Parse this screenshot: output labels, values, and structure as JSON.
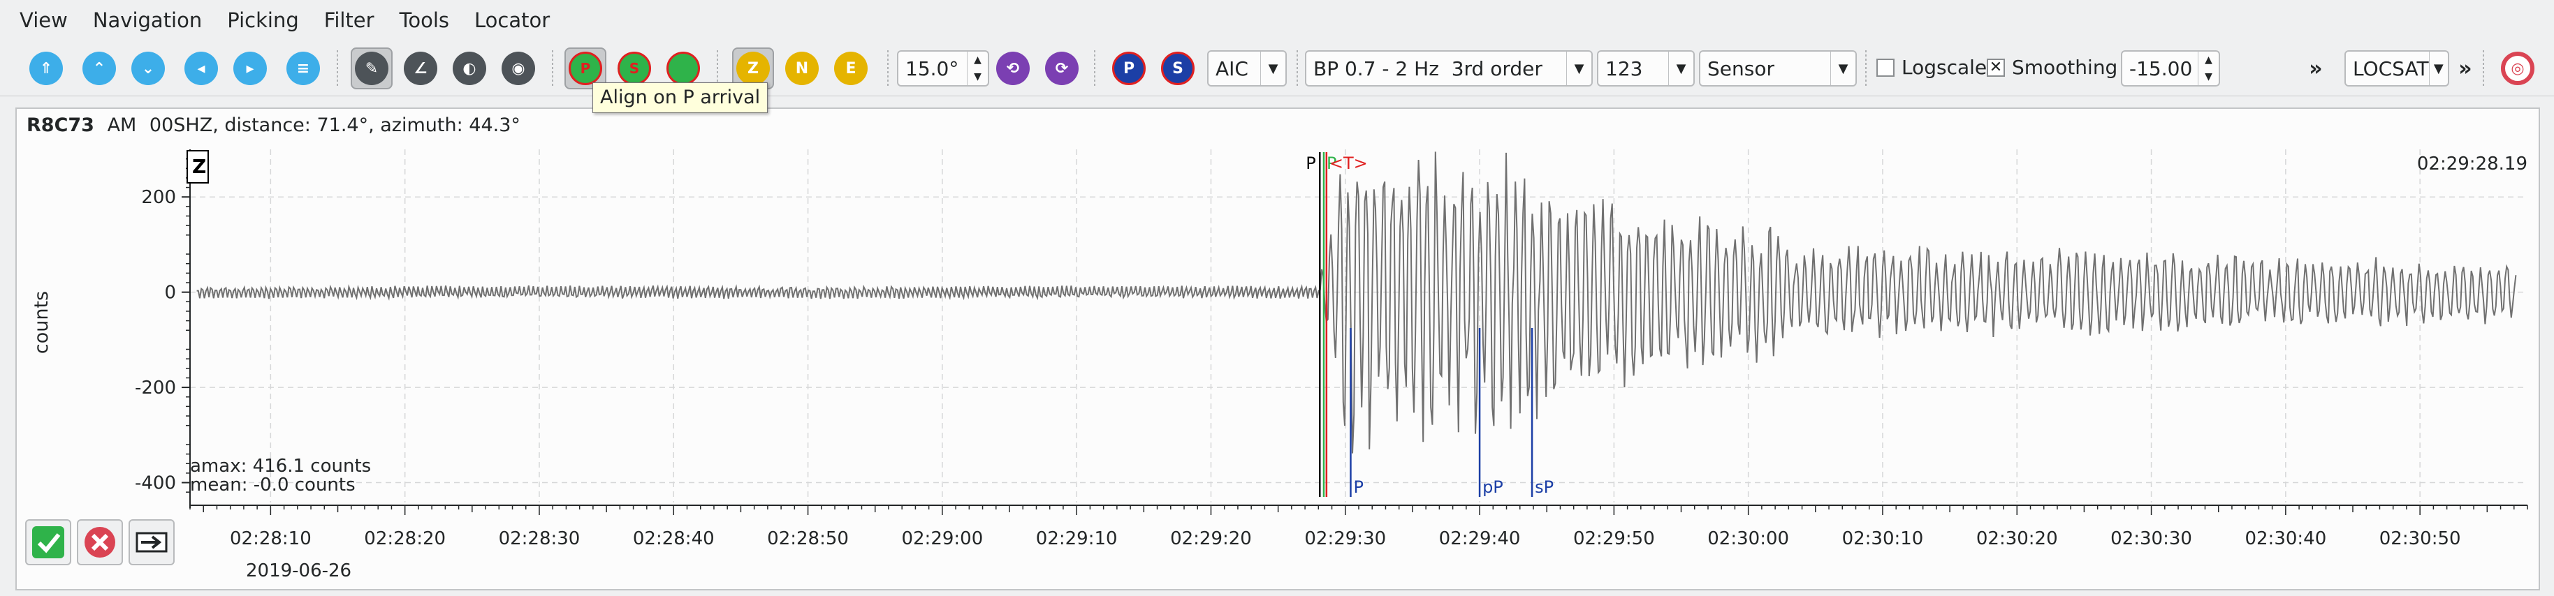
{
  "menubar": {
    "items": [
      "View",
      "Navigation",
      "Picking",
      "Filter",
      "Tools",
      "Locator"
    ]
  },
  "toolbar": {
    "nav_icons": [
      "home-icon",
      "scroll-up-icon",
      "scroll-down-icon",
      "previous-icon",
      "next-icon",
      "sort-icon"
    ],
    "tool_icons": [
      "pick-tool-icon",
      "measure-tool-icon",
      "spectrum-tool-icon",
      "record-tool-icon"
    ],
    "align_buttons": [
      {
        "label": "P",
        "name": "align-p-button",
        "color": "#2fb34a"
      },
      {
        "label": "S",
        "name": "align-s-button",
        "color": "#2fb34a"
      },
      {
        "label": "",
        "name": "align-reset-button",
        "color": "#2fb34a"
      }
    ],
    "component_buttons": [
      {
        "label": "Z",
        "name": "component-z-button",
        "color": "#e5b400",
        "pressed": true
      },
      {
        "label": "N",
        "name": "component-n-button",
        "color": "#e5b400",
        "pressed": false
      },
      {
        "label": "E",
        "name": "component-e-button",
        "color": "#e5b400",
        "pressed": false
      }
    ],
    "rotation_angle": "15.0°",
    "pick_method": "AIC",
    "filter": "BP 0.7 - 2 Hz  3rd order",
    "rotation": "123",
    "unit": "Sensor",
    "logscale_label": "Logscale",
    "logscale_checked": false,
    "smoothing_label": "Smoothing",
    "smoothing_checked": true,
    "value": "-15.00",
    "overflow": "»",
    "locator": "LOCSAT",
    "colors": {
      "green": "#2fb34a",
      "yellow": "#e5b400",
      "blue": "#1c3fa6",
      "purple": "#7b3fb2",
      "red": "#da4453"
    }
  },
  "tooltip": {
    "text": "Align on P arrival"
  },
  "trace": {
    "station": "R8C73",
    "network": "AM",
    "channel_info": "00SHZ, distance: 71.4°, azimuth: 44.3°",
    "component": "Z",
    "time_label": "02:29:28.19",
    "ylabel": "counts",
    "amax": "amax: 416.1 counts",
    "mean": "mean: -0.0 counts",
    "date": "2019-06-26",
    "picks": {
      "P_black": "P",
      "P_green": "P",
      "T": "<T>"
    },
    "theoretical": [
      "P",
      "pP",
      "sP"
    ]
  },
  "chart_data": {
    "type": "line",
    "title": "",
    "xlabel": "",
    "ylabel": "counts",
    "ylim": [
      -430,
      300
    ],
    "yticks": [
      200,
      0,
      -200,
      -400
    ],
    "ytick_labels": [
      "200",
      "0",
      "-200",
      "-400"
    ],
    "x_range": [
      "02:28:04",
      "02:30:58"
    ],
    "xticks": [
      "02:28:10",
      "02:28:20",
      "02:28:30",
      "02:28:40",
      "02:28:50",
      "02:29:00",
      "02:29:10",
      "02:29:20",
      "02:29:30",
      "02:29:40",
      "02:29:50",
      "02:30:00",
      "02:30:10",
      "02:30:20",
      "02:30:30",
      "02:30:40",
      "02:30:50"
    ],
    "grid": true,
    "series": [
      {
        "color": "#707070"
      }
    ],
    "markers": [
      {
        "label": "P",
        "time": "02:29:28.1",
        "color": "#000000"
      },
      {
        "label": "P",
        "time": "02:29:28.4",
        "color": "#2fb34a"
      },
      {
        "label": "<T>",
        "time": "02:29:28.6",
        "color": "#e02020"
      },
      {
        "label": "P",
        "time": "02:29:30.4",
        "color": "#1c3fa6"
      },
      {
        "label": "pP",
        "time": "02:29:40.0",
        "color": "#1c3fa6"
      },
      {
        "label": "sP",
        "time": "02:29:43.9",
        "color": "#1c3fa6"
      }
    ]
  },
  "bottom": {
    "accept_icon": "accept-icon",
    "reject_icon": "reject-icon",
    "skip_icon": "skip-icon"
  }
}
